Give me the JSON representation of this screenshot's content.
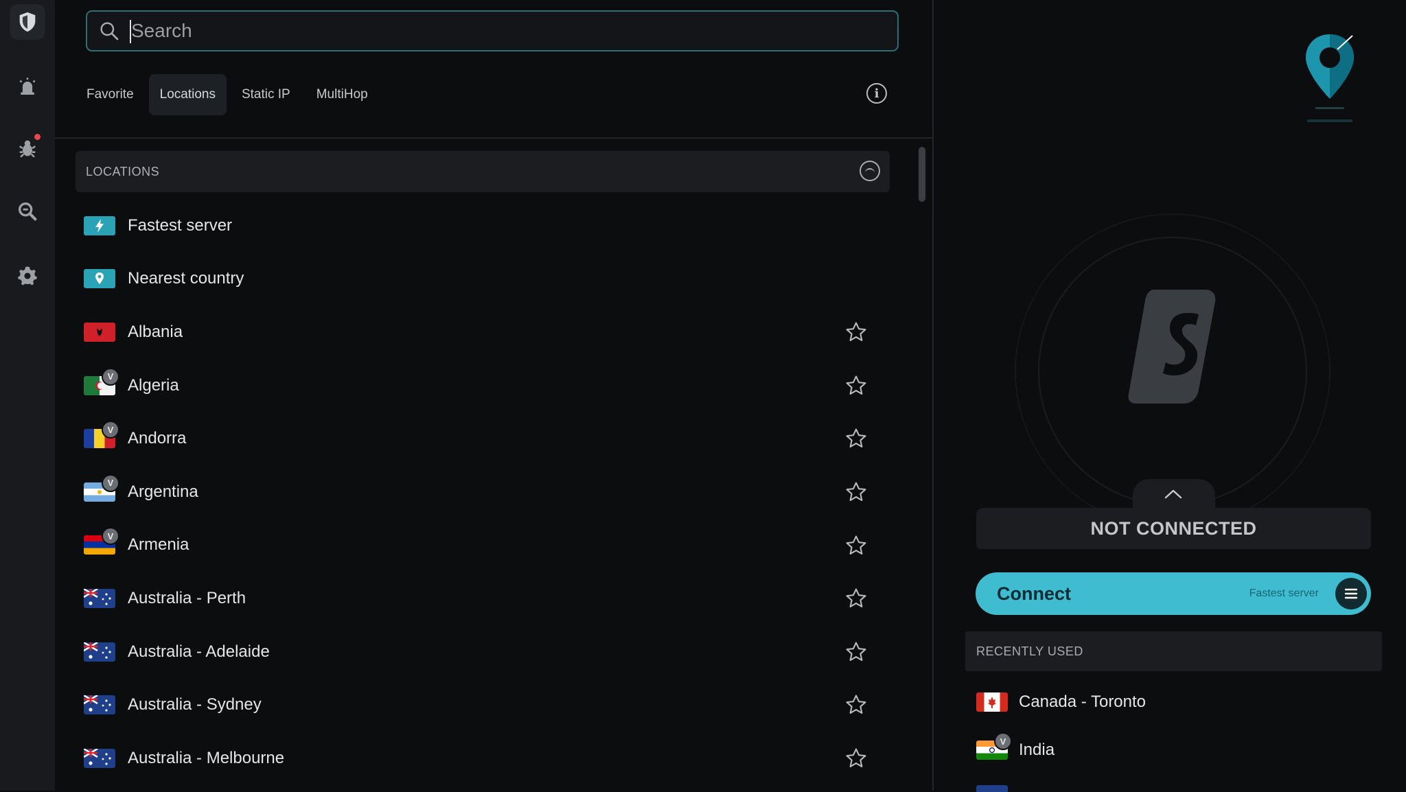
{
  "search": {
    "placeholder": "Search"
  },
  "tabs": [
    {
      "label": "Favorite"
    },
    {
      "label": "Locations",
      "active": true
    },
    {
      "label": "Static IP"
    },
    {
      "label": "MultiHop"
    }
  ],
  "info_glyph": "i",
  "section": {
    "title": "LOCATIONS"
  },
  "locations": [
    {
      "label": "Fastest server",
      "icon": "bolt-icon",
      "starred": false
    },
    {
      "label": "Nearest country",
      "icon": "location-pin-icon",
      "starred": false
    },
    {
      "label": "Albania",
      "flag": "flag-albania",
      "virtual": false
    },
    {
      "label": "Algeria",
      "flag": "flag-algeria",
      "virtual": true
    },
    {
      "label": "Andorra",
      "flag": "flag-andorra",
      "virtual": true
    },
    {
      "label": "Argentina",
      "flag": "flag-argentina",
      "virtual": true
    },
    {
      "label": "Armenia",
      "flag": "flag-armenia",
      "virtual": true
    },
    {
      "label": "Australia - Perth",
      "flag": "flag-australia",
      "virtual": false
    },
    {
      "label": "Australia - Adelaide",
      "flag": "flag-australia",
      "virtual": false
    },
    {
      "label": "Australia - Sydney",
      "flag": "flag-australia",
      "virtual": false
    },
    {
      "label": "Australia - Melbourne",
      "flag": "flag-australia",
      "virtual": false
    }
  ],
  "virtual_badge": "V",
  "status": {
    "label": "NOT CONNECTED"
  },
  "connect": {
    "label": "Connect",
    "target": "Fastest server"
  },
  "recent": {
    "title": "RECENTLY USED",
    "items": [
      {
        "label": "Canada - Toronto",
        "flag": "flag-canada",
        "virtual": false
      },
      {
        "label": "India",
        "flag": "flag-india",
        "virtual": true
      }
    ]
  },
  "colors": {
    "accent": "#3fbcd0",
    "background": "#0c0d0f",
    "panel": "#1b1d21",
    "sidebar": "#181a1d"
  }
}
